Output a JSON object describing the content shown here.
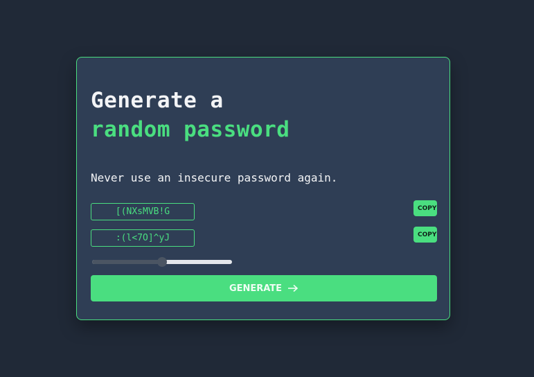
{
  "header": {
    "title_line1": "Generate a",
    "title_line2": "random password"
  },
  "subtitle": "Never use an insecure password again.",
  "passwords": [
    {
      "value": "[(NXsMVB!G",
      "copy_label": "COPY"
    },
    {
      "value": ":(l<7O]^yJ",
      "copy_label": "COPY"
    }
  ],
  "length_slider": {
    "min": 0,
    "max": 100,
    "value": 50
  },
  "generate_button": {
    "label": "GENERATE",
    "icon": "arrow-right-icon"
  },
  "colors": {
    "accent": "#4ade80",
    "background": "#202937",
    "card": "#2f3e55"
  }
}
